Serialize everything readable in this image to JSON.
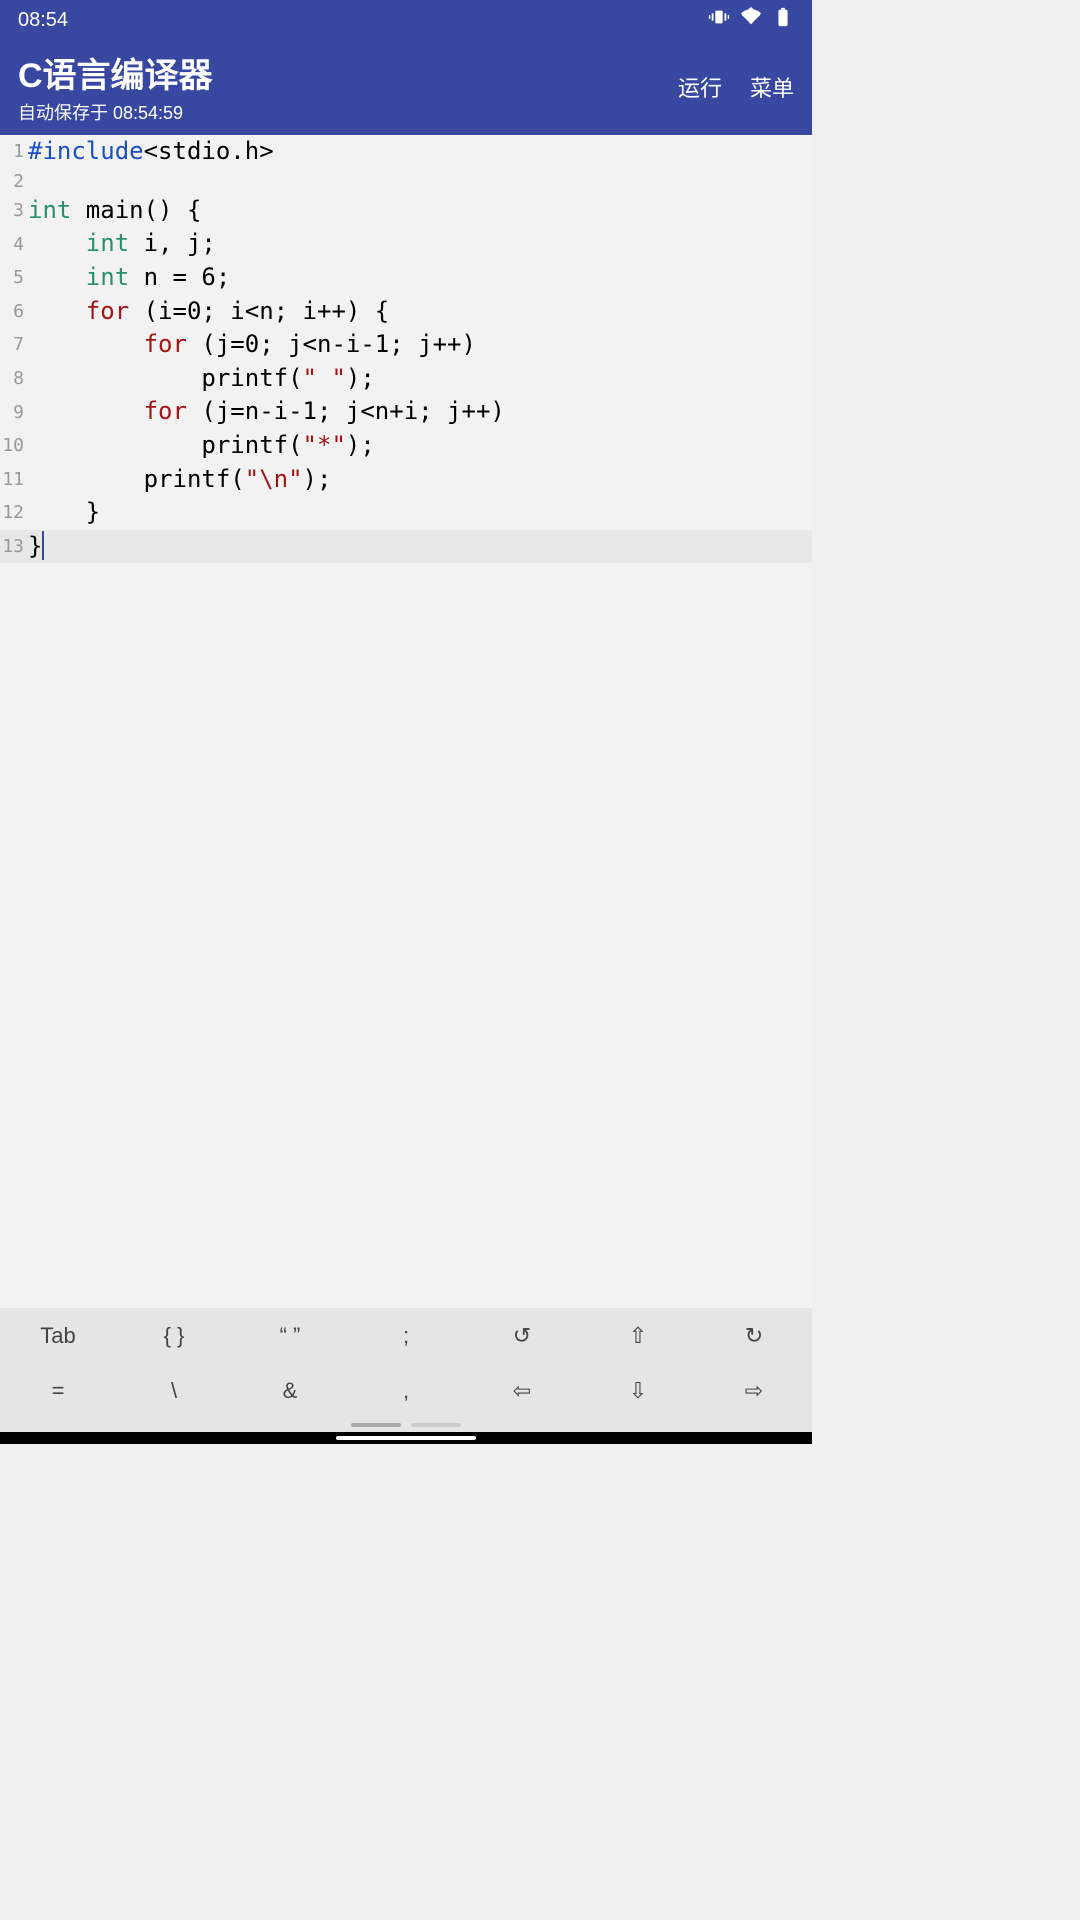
{
  "status": {
    "time": "08:54"
  },
  "header": {
    "title": "C语言编译器",
    "subtitle": "自动保存于 08:54:59",
    "run": "运行",
    "menu": "菜单"
  },
  "code": {
    "lines": [
      {
        "n": "1",
        "tokens": [
          {
            "t": "#include",
            "c": "kw-pp"
          },
          {
            "t": "<stdio.h>",
            "c": ""
          }
        ]
      },
      {
        "n": "2",
        "tokens": []
      },
      {
        "n": "3",
        "tokens": [
          {
            "t": "int",
            "c": "kw-type"
          },
          {
            "t": " main() {",
            "c": ""
          }
        ]
      },
      {
        "n": "4",
        "tokens": [
          {
            "t": "    ",
            "c": ""
          },
          {
            "t": "int",
            "c": "kw-type"
          },
          {
            "t": " i, j;",
            "c": ""
          }
        ]
      },
      {
        "n": "5",
        "tokens": [
          {
            "t": "    ",
            "c": ""
          },
          {
            "t": "int",
            "c": "kw-type"
          },
          {
            "t": " n = 6;",
            "c": ""
          }
        ]
      },
      {
        "n": "6",
        "tokens": [
          {
            "t": "    ",
            "c": ""
          },
          {
            "t": "for",
            "c": "kw-ctrl"
          },
          {
            "t": " (i=0; i<n; i++) {",
            "c": ""
          }
        ]
      },
      {
        "n": "7",
        "tokens": [
          {
            "t": "        ",
            "c": ""
          },
          {
            "t": "for",
            "c": "kw-ctrl"
          },
          {
            "t": " (j=0; j<n-i-1; j++)",
            "c": ""
          }
        ]
      },
      {
        "n": "8",
        "tokens": [
          {
            "t": "            printf(",
            "c": ""
          },
          {
            "t": "\" \"",
            "c": "kw-str"
          },
          {
            "t": ");",
            "c": ""
          }
        ]
      },
      {
        "n": "9",
        "tokens": [
          {
            "t": "        ",
            "c": ""
          },
          {
            "t": "for",
            "c": "kw-ctrl"
          },
          {
            "t": " (j=n-i-1; j<n+i; j++)",
            "c": ""
          }
        ]
      },
      {
        "n": "10",
        "tokens": [
          {
            "t": "            printf(",
            "c": ""
          },
          {
            "t": "\"*\"",
            "c": "kw-str"
          },
          {
            "t": ");",
            "c": ""
          }
        ]
      },
      {
        "n": "11",
        "tokens": [
          {
            "t": "        printf(",
            "c": ""
          },
          {
            "t": "\"\\n\"",
            "c": "kw-str"
          },
          {
            "t": ");",
            "c": ""
          }
        ]
      },
      {
        "n": "12",
        "tokens": [
          {
            "t": "    }",
            "c": ""
          }
        ]
      },
      {
        "n": "13",
        "tokens": [
          {
            "t": "}",
            "c": ""
          }
        ],
        "active": true,
        "cursor": true
      }
    ]
  },
  "keys": {
    "row1": [
      "Tab",
      "{ }",
      "“ ”",
      ";",
      "↺",
      "⇧",
      "↻"
    ],
    "row2": [
      "=",
      "\\",
      "&",
      ",",
      "⇦",
      "⇩",
      "⇨"
    ]
  }
}
